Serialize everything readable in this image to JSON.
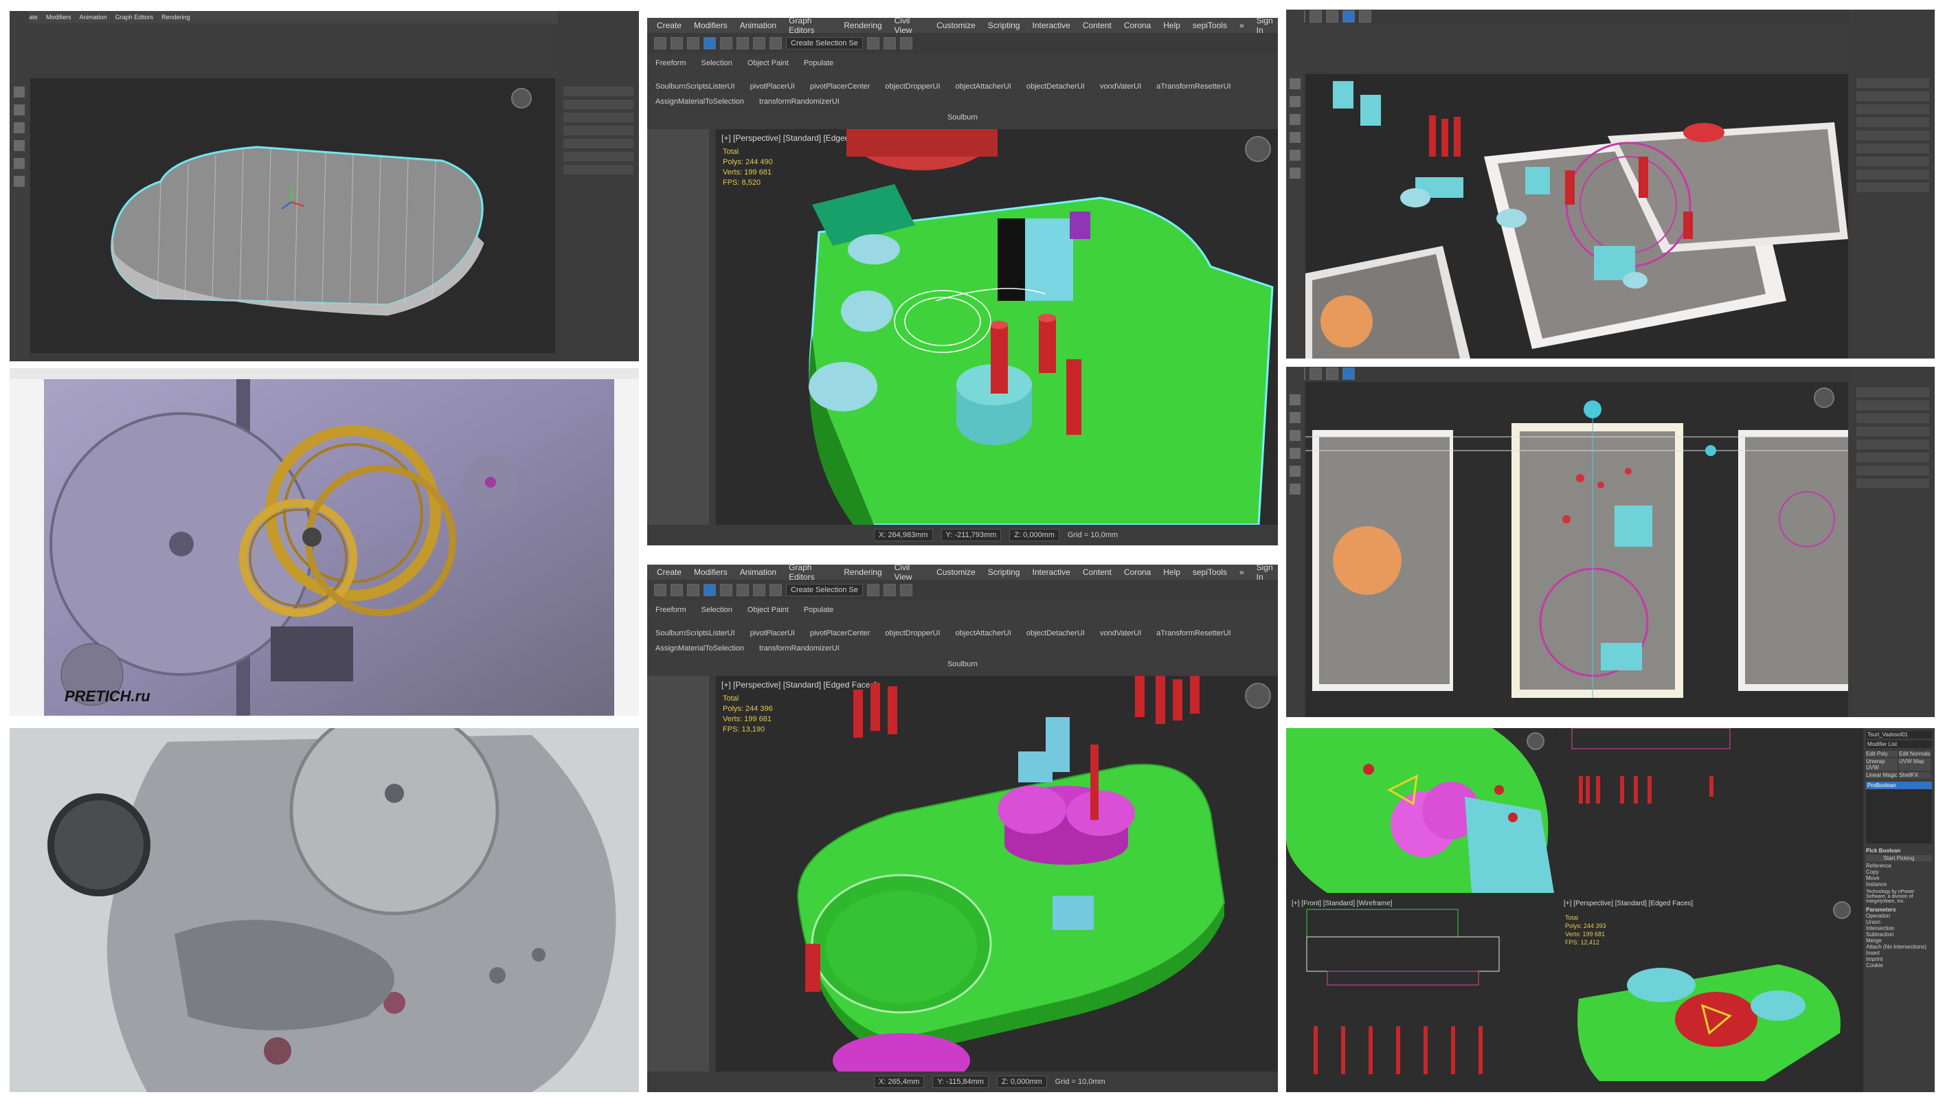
{
  "menu": {
    "items": [
      "Create",
      "Modifiers",
      "Animation",
      "Graph Editors",
      "Rendering",
      "Civil View",
      "Customize",
      "Scripting",
      "Interactive",
      "Content",
      "Corona",
      "Help",
      "sepiTools"
    ],
    "more": "»",
    "sign_in": "Sign In"
  },
  "toolbar": {
    "selection_set": "Create Selection Se"
  },
  "ribbon": {
    "tabs": [
      "Freeform",
      "Selection",
      "Object Paint",
      "Populate"
    ],
    "scripts": [
      "SoulburnScriptsListerUI",
      "pivotPlacerUI",
      "pivotPlacerCenter",
      "objectDropperUI",
      "objectAttacherUI",
      "objectDetacherUI",
      "vondVaterUI",
      "aTransformResetterUI",
      "AssignMaterialToSelection",
      "transformRandomizerUI"
    ],
    "group_label": "Soulburn"
  },
  "viewport_top": {
    "label": "[+] [Perspective] [Standard] [Edged Faces]",
    "stats": {
      "total": "Total",
      "polys": "Polys:   244 490",
      "verts": "Verts:   199 681",
      "fps": "FPS:    8,520"
    }
  },
  "viewport_bottom": {
    "label": "[+] [Perspective] [Standard] [Edged Faces]",
    "stats": {
      "total": "Total",
      "polys": "Polys:   244 396",
      "verts": "Verts:   199 681",
      "fps": "FPS:    13,190"
    }
  },
  "status_top": {
    "x": "X: 264,983mm",
    "y": "Y: -211,793mm",
    "z": "Z: 0,000mm",
    "grid": "Grid = 10,0mm"
  },
  "status_bottom": {
    "x": "X: 265,4mm",
    "y": "Y: -115,84mm",
    "z": "Z: 0,000mm",
    "grid": "Grid = 10,0mm"
  },
  "photo_watermark": "PRETICH.ru",
  "texture_watermark": "PRETICH.ru",
  "bottom_right": {
    "front_label": "[+] [Front] [Standard] [Wireframe]",
    "persp_label": "[+] [Perspective] [Standard] [Edged Faces]",
    "stats": {
      "total": "Total",
      "polys": "Polys:   244 393",
      "verts": "Verts:   199 681",
      "fps": "FPS:    12,412"
    },
    "modifier_list": "Modifier List",
    "object_name": "Tsurt_Vadosol01",
    "buttons": [
      "Edit Poly",
      "Edit Normals",
      "Unwrap UVW",
      "UVW Map",
      "Linear Magic",
      "ShellFX"
    ],
    "stack_item": "ProBoolean",
    "pick_boolean": "Pick Boolean",
    "start_picking": "Start Picking",
    "options": [
      "Reference",
      "Copy",
      "Move",
      "Instance"
    ],
    "tech_note": "Technology by nPower Software, a division of IntegrityWare, Inc.",
    "parameters": "Parameters",
    "operation": "Operation",
    "ops": [
      "Union",
      "Intersection",
      "Subtraction",
      "Merge",
      "Attach (No Intersections)",
      "Insert"
    ],
    "imprint": "Imprint",
    "cookie": "Cookie"
  },
  "colors": {
    "green_model": "#3fd23c",
    "red_pins": "#c8262a",
    "cyan_parts": "#73d4e0",
    "magenta_parts": "#cc3cc8",
    "viewport_bg": "#2b2b2b",
    "ui_bg": "#3b3b3b"
  }
}
